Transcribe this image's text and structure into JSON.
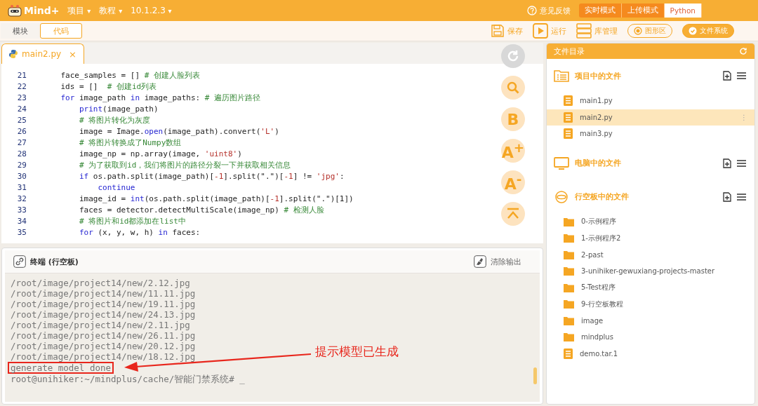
{
  "app": {
    "logo": "Mind+",
    "menus": [
      {
        "label": "项目",
        "caret": "▾"
      },
      {
        "label": "教程",
        "caret": "▾"
      },
      {
        "label": "10.1.2.3",
        "caret": "▾"
      }
    ],
    "feedback": "意见反馈",
    "modes": [
      {
        "label": "实时模式",
        "selected": false
      },
      {
        "label": "上传模式",
        "selected": false
      },
      {
        "label": "Python",
        "selected": true
      }
    ]
  },
  "view_tabs": [
    {
      "label": "模块",
      "selected": false
    },
    {
      "label": "代码",
      "selected": true
    }
  ],
  "toolbar": [
    {
      "kind": "save",
      "label": "保存"
    },
    {
      "kind": "run",
      "label": "运行"
    },
    {
      "kind": "library",
      "label": "库管理"
    },
    {
      "kind": "graphic",
      "label": "图形区"
    },
    {
      "kind": "filesystem",
      "label": "文件系统"
    }
  ],
  "editor": {
    "tab": "main2.py",
    "close": "×",
    "lines": [
      {
        "number": "21",
        "tokens": [
          {
            "kind": "plain",
            "text": "    face_samples = [] "
          },
          {
            "kind": "comment",
            "text": "# 创建人脸列表"
          }
        ]
      },
      {
        "number": "22",
        "tokens": [
          {
            "kind": "plain",
            "text": "    ids = []  "
          },
          {
            "kind": "comment",
            "text": "# 创建id列表"
          }
        ]
      },
      {
        "number": "23",
        "tokens": [
          {
            "kind": "keyword",
            "text": "    for"
          },
          {
            "kind": "plain",
            "text": " image_path "
          },
          {
            "kind": "keyword",
            "text": "in"
          },
          {
            "kind": "plain",
            "text": " image_paths: "
          },
          {
            "kind": "comment",
            "text": "# 遍历图片路径"
          }
        ]
      },
      {
        "number": "24",
        "tokens": [
          {
            "kind": "keyword",
            "text": "        print"
          },
          {
            "kind": "plain",
            "text": "(image_path)"
          }
        ]
      },
      {
        "number": "25",
        "tokens": [
          {
            "kind": "comment",
            "text": "        # 将图片转化为灰度"
          }
        ]
      },
      {
        "number": "26",
        "tokens": [
          {
            "kind": "plain",
            "text": "        image = Image."
          },
          {
            "kind": "keyword",
            "text": "open"
          },
          {
            "kind": "plain",
            "text": "(image_path).convert("
          },
          {
            "kind": "string",
            "text": "'L'"
          },
          {
            "kind": "plain",
            "text": ")"
          }
        ]
      },
      {
        "number": "27",
        "tokens": [
          {
            "kind": "comment",
            "text": "        # 将图片转换成了Numpy数组"
          }
        ]
      },
      {
        "number": "28",
        "tokens": [
          {
            "kind": "plain",
            "text": "        image_np = np.array(image, "
          },
          {
            "kind": "string",
            "text": "'uint8'"
          },
          {
            "kind": "plain",
            "text": ")"
          }
        ]
      },
      {
        "number": "29",
        "tokens": [
          {
            "kind": "comment",
            "text": "        # 为了获取到id，我们将图片的路径分裂一下并获取相关信息"
          }
        ]
      },
      {
        "number": "30",
        "tokens": [
          {
            "kind": "keyword",
            "text": "        if"
          },
          {
            "kind": "plain",
            "text": " os.path.split(image_path)["
          },
          {
            "kind": "number",
            "text": "-1"
          },
          {
            "kind": "plain",
            "text": "].split(\".\")["
          },
          {
            "kind": "number",
            "text": "-1"
          },
          {
            "kind": "plain",
            "text": "] != "
          },
          {
            "kind": "string",
            "text": "'jpg'"
          },
          {
            "kind": "plain",
            "text": ":"
          }
        ]
      },
      {
        "number": "31",
        "tokens": [
          {
            "kind": "keyword",
            "text": "            continue"
          }
        ]
      },
      {
        "number": "32",
        "tokens": [
          {
            "kind": "plain",
            "text": "        image_id = "
          },
          {
            "kind": "keyword",
            "text": "int"
          },
          {
            "kind": "plain",
            "text": "(os.path.split(image_path)["
          },
          {
            "kind": "number",
            "text": "-1"
          },
          {
            "kind": "plain",
            "text": "].split(\".\")[1])"
          }
        ]
      },
      {
        "number": "33",
        "tokens": [
          {
            "kind": "plain",
            "text": "        faces = detector.detectMultiScale(image_np) "
          },
          {
            "kind": "comment",
            "text": "# 检测人脸"
          }
        ]
      },
      {
        "number": "34",
        "tokens": [
          {
            "kind": "comment",
            "text": "        # 将图片和id都添加在list中"
          }
        ]
      },
      {
        "number": "35",
        "tokens": [
          {
            "kind": "keyword",
            "text": "        for"
          },
          {
            "kind": "plain",
            "text": " (x, y, w, h) "
          },
          {
            "kind": "keyword",
            "text": "in"
          },
          {
            "kind": "plain",
            "text": " faces:"
          }
        ]
      }
    ]
  },
  "tools": [
    {
      "kind": "refresh",
      "disabled": true
    },
    {
      "kind": "search",
      "disabled": false
    },
    {
      "kind": "text",
      "label": "B",
      "disabled": false
    },
    {
      "kind": "text",
      "label": "A$^{+}$",
      "disabled": false
    },
    {
      "kind": "text",
      "label": "A$^{-}$",
      "disabled": false
    },
    {
      "kind": "top",
      "disabled": false
    }
  ],
  "terminal": {
    "title": "终端 (行空板)",
    "clear": "清除输出",
    "annotation": "提示模型已生成",
    "lines": [
      {
        "text": "/root/image/project14/new/2.12.jpg",
        "highlighted": false
      },
      {
        "text": "/root/image/project14/new/11.11.jpg",
        "highlighted": false
      },
      {
        "text": "/root/image/project14/new/19.11.jpg",
        "highlighted": false
      },
      {
        "text": "/root/image/project14/new/24.13.jpg",
        "highlighted": false
      },
      {
        "text": "/root/image/project14/new/2.11.jpg",
        "highlighted": false
      },
      {
        "text": "/root/image/project14/new/26.11.jpg",
        "highlighted": false
      },
      {
        "text": "/root/image/project14/new/20.12.jpg",
        "highlighted": false
      },
      {
        "text": "/root/image/project14/new/18.12.jpg",
        "highlighted": false
      },
      {
        "text": "generate model done",
        "highlighted": true
      },
      {
        "text": "root@unihiker:~/mindplus/cache/智能门禁系统# _",
        "highlighted": false
      }
    ]
  },
  "files": {
    "title": "文件目录",
    "sections": [
      {
        "kind": "project",
        "title": "项目中的文件",
        "items": [
          {
            "kind": "file",
            "name": "main1.py",
            "selected": false
          },
          {
            "kind": "file",
            "name": "main2.py",
            "selected": true,
            "more": "⋮"
          },
          {
            "kind": "file",
            "name": "main3.py",
            "selected": false
          }
        ]
      },
      {
        "kind": "computer",
        "title": "电脑中的文件"
      },
      {
        "kind": "board",
        "title": "行空板中的文件",
        "items": [
          {
            "kind": "folder",
            "name": "0-示例程序",
            "selected": false
          },
          {
            "kind": "folder",
            "name": "1-示例程序2",
            "selected": false
          },
          {
            "kind": "folder",
            "name": "2-past",
            "selected": false
          },
          {
            "kind": "folder",
            "name": "3-unihiker-gewuxiang-projects-master",
            "selected": false
          },
          {
            "kind": "folder",
            "name": "5-Test程序",
            "selected": false
          },
          {
            "kind": "folder",
            "name": "9-行空板教程",
            "selected": false
          },
          {
            "kind": "folder",
            "name": "image",
            "selected": false
          },
          {
            "kind": "folder",
            "name": "mindplus",
            "selected": false
          },
          {
            "kind": "file",
            "name": "demo.tar.1",
            "selected": false
          }
        ]
      }
    ]
  }
}
